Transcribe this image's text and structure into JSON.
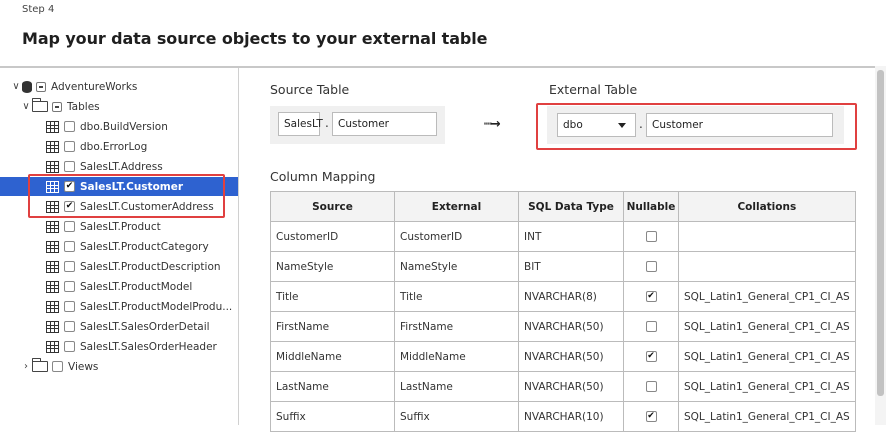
{
  "step_label": "Step 4",
  "heading": "Map your data source objects to your external table",
  "tree": {
    "database": "AdventureWorks",
    "tables_folder": "Tables",
    "views_folder": "Views",
    "tables": [
      {
        "name": "dbo.BuildVersion",
        "checked": false
      },
      {
        "name": "dbo.ErrorLog",
        "checked": false
      },
      {
        "name": "SalesLT.Address",
        "checked": false
      },
      {
        "name": "SalesLT.Customer",
        "checked": true,
        "selected": true
      },
      {
        "name": "SalesLT.CustomerAddress",
        "checked": true
      },
      {
        "name": "SalesLT.Product",
        "checked": false
      },
      {
        "name": "SalesLT.ProductCategory",
        "checked": false
      },
      {
        "name": "SalesLT.ProductDescription",
        "checked": false
      },
      {
        "name": "SalesLT.ProductModel",
        "checked": false
      },
      {
        "name": "SalesLT.ProductModelProdu...",
        "checked": false
      },
      {
        "name": "SalesLT.SalesOrderDetail",
        "checked": false
      },
      {
        "name": "SalesLT.SalesOrderHeader",
        "checked": false
      }
    ]
  },
  "source_table": {
    "label": "Source Table",
    "schema": "SalesLT",
    "separator": ".",
    "name": "Customer"
  },
  "external_table": {
    "label": "External Table",
    "schema": "dbo",
    "separator": ".",
    "name": "Customer"
  },
  "column_mapping": {
    "label": "Column Mapping",
    "headers": [
      "Source",
      "External",
      "SQL Data Type",
      "Nullable",
      "Collations"
    ],
    "rows": [
      {
        "source": "CustomerID",
        "external": "CustomerID",
        "type": "INT",
        "nullable": false,
        "collation": ""
      },
      {
        "source": "NameStyle",
        "external": "NameStyle",
        "type": "BIT",
        "nullable": false,
        "collation": ""
      },
      {
        "source": "Title",
        "external": "Title",
        "type": "NVARCHAR(8)",
        "nullable": true,
        "collation": "SQL_Latin1_General_CP1_CI_AS"
      },
      {
        "source": "FirstName",
        "external": "FirstName",
        "type": "NVARCHAR(50)",
        "nullable": false,
        "collation": "SQL_Latin1_General_CP1_CI_AS"
      },
      {
        "source": "MiddleName",
        "external": "MiddleName",
        "type": "NVARCHAR(50)",
        "nullable": true,
        "collation": "SQL_Latin1_General_CP1_CI_AS"
      },
      {
        "source": "LastName",
        "external": "LastName",
        "type": "NVARCHAR(50)",
        "nullable": false,
        "collation": "SQL_Latin1_General_CP1_CI_AS"
      },
      {
        "source": "Suffix",
        "external": "Suffix",
        "type": "NVARCHAR(10)",
        "nullable": true,
        "collation": "SQL_Latin1_General_CP1_CI_AS"
      }
    ]
  },
  "colors": {
    "selection": "#2e62d0",
    "highlight": "#e04040"
  }
}
